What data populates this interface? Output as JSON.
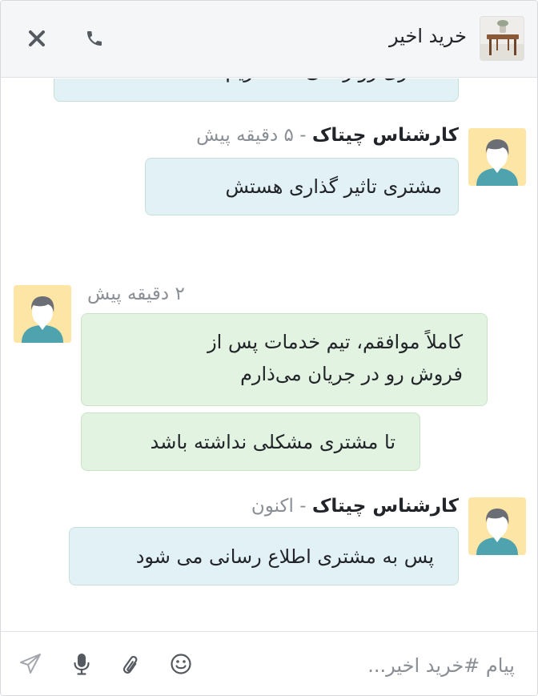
{
  "header": {
    "title": "خرید اخیر",
    "thumbnail_icon": "coffee-table-image",
    "close_icon": "close-icon",
    "call_icon": "phone-icon"
  },
  "messages": [
    {
      "side": "them",
      "truncated": true,
      "lines": [
        "مشتری رو راضی نگه داریم"
      ]
    },
    {
      "side": "them",
      "author": "کارشناس چیتاک",
      "time": " - ۵ دقیقه پیش",
      "lines": [
        "مشتری تاثیر گذاری هستش"
      ]
    },
    {
      "side": "me",
      "time": "۲ دقیقه پیش",
      "lines": [
        "کاملاً موافقم، تیم خدمات پس از",
        "فروش رو در جریان می‌ذارم"
      ]
    },
    {
      "side": "me",
      "lines": [
        "تا مشتری مشکلی نداشته باشد"
      ]
    },
    {
      "side": "them",
      "author": "کارشناس چیتاک",
      "time": " - اکنون",
      "lines": [
        "پس به مشتری اطلاع رسانی می شود"
      ]
    }
  ],
  "composer": {
    "placeholder": "پیام #خرید اخیر...",
    "value": "",
    "icons": [
      "send-icon",
      "microphone-icon",
      "paperclip-icon",
      "emoji-icon"
    ]
  },
  "colors": {
    "header_bg": "#f5f6f8",
    "bubble_them": "#e2f1f6",
    "bubble_me": "#e3f3e1",
    "avatar_bg": "#fde5a6",
    "icon": "#555a61"
  }
}
